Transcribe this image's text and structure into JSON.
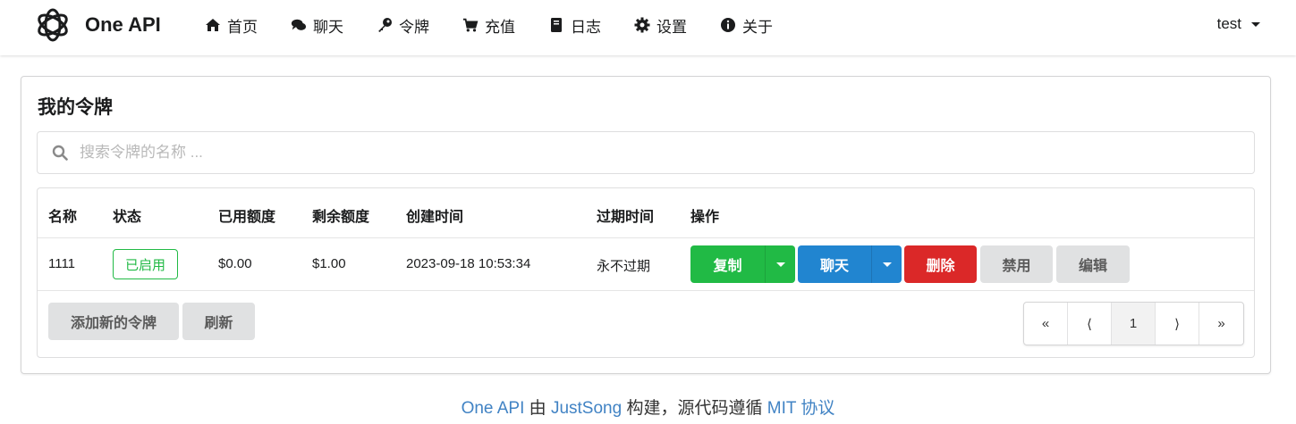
{
  "app": {
    "name": "One API"
  },
  "nav": {
    "items": [
      {
        "label": "首页",
        "icon": "home-icon"
      },
      {
        "label": "聊天",
        "icon": "chat-icon"
      },
      {
        "label": "令牌",
        "icon": "key-icon"
      },
      {
        "label": "充值",
        "icon": "cart-icon"
      },
      {
        "label": "日志",
        "icon": "book-icon"
      },
      {
        "label": "设置",
        "icon": "gear-icon"
      },
      {
        "label": "关于",
        "icon": "info-icon"
      }
    ],
    "user": "test"
  },
  "page": {
    "title": "我的令牌",
    "search_placeholder": "搜索令牌的名称 ..."
  },
  "table": {
    "headers": [
      "名称",
      "状态",
      "已用额度",
      "剩余额度",
      "创建时间",
      "过期时间",
      "操作"
    ],
    "rows": [
      {
        "name": "1111",
        "status": "已启用",
        "used": "$0.00",
        "remaining": "$1.00",
        "created": "2023-09-18 10:53:34",
        "expires": "永不过期",
        "actions": {
          "copy": "复制",
          "chat": "聊天",
          "delete": "删除",
          "disable": "禁用",
          "edit": "编辑"
        }
      }
    ]
  },
  "footer_buttons": {
    "add": "添加新的令牌",
    "refresh": "刷新"
  },
  "pagination": {
    "first": "«",
    "prev": "⟨",
    "current": "1",
    "next": "⟩",
    "last": "»"
  },
  "footer": {
    "app": "One API",
    "by": "由",
    "author": "JustSong",
    "rest": "构建，源代码遵循",
    "license": "MIT 协议"
  },
  "colors": {
    "green": "#21ba45",
    "blue": "#2185d0",
    "red": "#db2828",
    "grey": "#e0e1e2",
    "link": "#4183c4"
  }
}
